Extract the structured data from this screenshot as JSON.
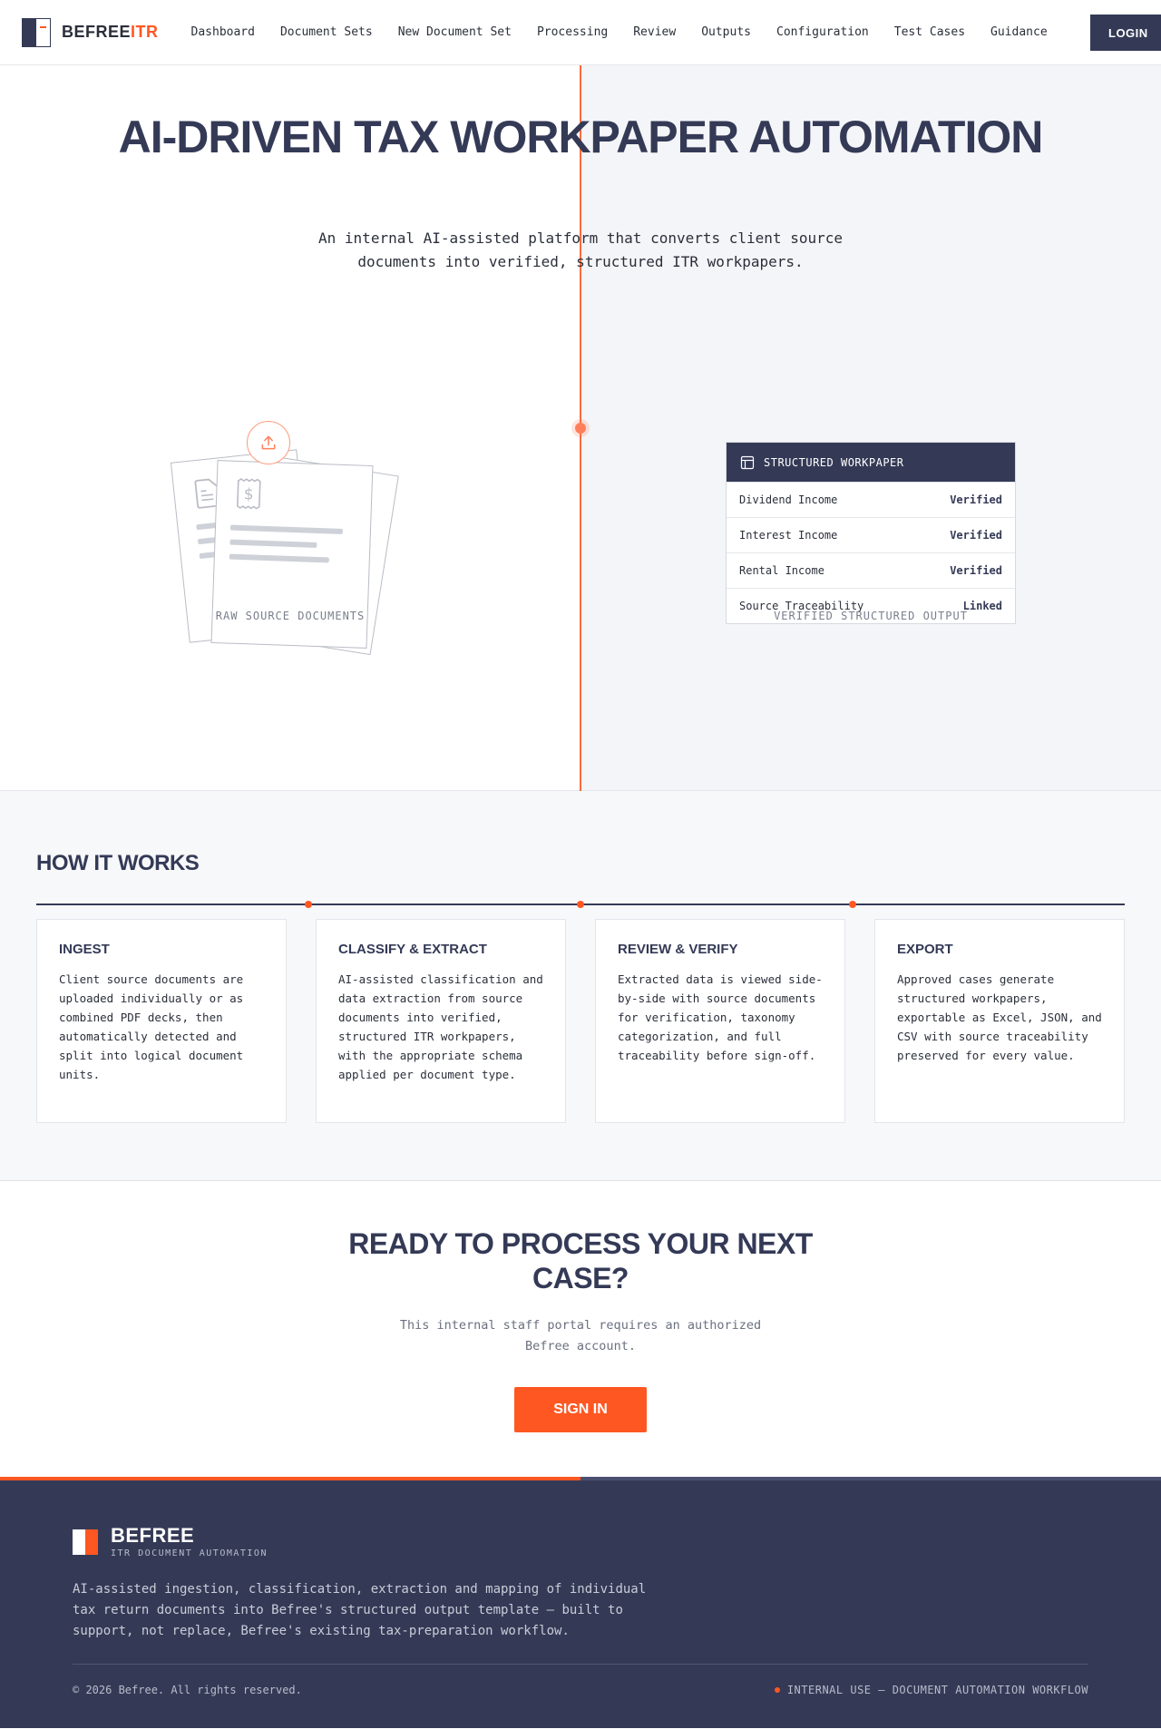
{
  "nav": {
    "brand_main": "BEFREE",
    "brand_accent": "ITR",
    "links": [
      "Dashboard",
      "Document Sets",
      "New Document Set",
      "Processing",
      "Review",
      "Outputs",
      "Configuration",
      "Test Cases",
      "Guidance"
    ],
    "login_label": "LOGIN"
  },
  "hero": {
    "title": "AI-DRIVEN TAX WORKPAPER AUTOMATION",
    "subtitle": "An internal AI-assisted platform that converts client source documents into verified, structured ITR workpapers.",
    "left_caption": "RAW SOURCE DOCUMENTS",
    "right_caption": "VERIFIED STRUCTURED OUTPUT",
    "workpaper": {
      "title": "STRUCTURED WORKPAPER",
      "rows": [
        {
          "label": "Dividend Income",
          "status": "Verified"
        },
        {
          "label": "Interest Income",
          "status": "Verified"
        },
        {
          "label": "Rental Income",
          "status": "Verified"
        },
        {
          "label": "Source Traceability",
          "status": "Linked"
        }
      ]
    }
  },
  "how": {
    "title": "HOW IT WORKS",
    "steps": [
      {
        "title": "INGEST",
        "text": "Client source documents are uploaded individually or as combined PDF decks, then automatically detected and split into logical document units."
      },
      {
        "title": "CLASSIFY & EXTRACT",
        "text": "AI-assisted classification and data extraction from source documents into verified, structured ITR workpapers, with the appropriate schema applied per document type."
      },
      {
        "title": "REVIEW & VERIFY",
        "text": "Extracted data is viewed side-by-side with source documents for verification, taxonomy categorization, and full traceability before sign-off."
      },
      {
        "title": "EXPORT",
        "text": "Approved cases generate structured workpapers, exportable as Excel, JSON, and CSV with source traceability preserved for every value."
      }
    ]
  },
  "cta": {
    "title": "READY TO PROCESS YOUR NEXT CASE?",
    "subtitle": "This internal staff portal requires an authorized Befree account.",
    "button": "SIGN IN"
  },
  "footer": {
    "brand": "BEFREE",
    "tagline": "ITR DOCUMENT AUTOMATION",
    "description": "AI-assisted ingestion, classification, extraction and mapping of individual tax return documents into Befree's structured output template — built to support, not replace, Befree's existing tax-preparation workflow.",
    "copyright": "© 2026 Befree. All rights reserved.",
    "status": "INTERNAL USE — DOCUMENT AUTOMATION WORKFLOW"
  },
  "colors": {
    "primary": "#343a56",
    "accent": "#ff5722"
  }
}
